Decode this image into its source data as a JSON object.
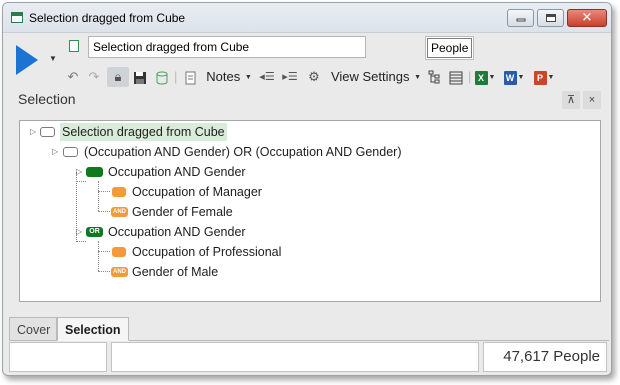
{
  "window": {
    "title": "Selection dragged from Cube",
    "controls": {
      "minimize": "minimize",
      "maximize": "maximize",
      "close": "✕"
    }
  },
  "toolbar": {
    "name_value": "Selection dragged from Cube",
    "people_label": "People",
    "notes_label": "Notes",
    "view_settings_label": "View Settings",
    "buttons": [
      "run-icon",
      "undo-icon",
      "redo-icon",
      "lock-icon",
      "save-icon",
      "database-icon",
      "notes-icon",
      "indent-icon",
      "outdent-icon",
      "settings-icon",
      "tree-icon",
      "table-icon",
      "excel-icon",
      "word-icon",
      "powerpoint-icon"
    ],
    "office": {
      "excel": "X",
      "word": "W",
      "powerpoint": "P"
    }
  },
  "pane": {
    "title": "Selection",
    "pin": "⊼",
    "close": "×"
  },
  "tree": {
    "root": "Selection dragged from Cube",
    "level1": "(Occupation AND Gender) OR (Occupation AND Gender)",
    "groups": [
      {
        "label": "Occupation AND Gender",
        "operator": "",
        "children": [
          "Occupation of Manager",
          "Gender of Female"
        ]
      },
      {
        "label": "Occupation AND Gender",
        "operator": "OR",
        "children": [
          "Occupation of Professional",
          "Gender of Male"
        ]
      }
    ],
    "and_chip": "AND"
  },
  "tabs": [
    {
      "label": "Cover",
      "active": false
    },
    {
      "label": "Selection",
      "active": true
    }
  ],
  "status": {
    "count": "47,617 People"
  },
  "colors": {
    "accent_blue": "#1b74d3",
    "and_green": "#0e7a1c",
    "orange": "#f39a3a",
    "root_highlight": "#d9ecd9"
  }
}
